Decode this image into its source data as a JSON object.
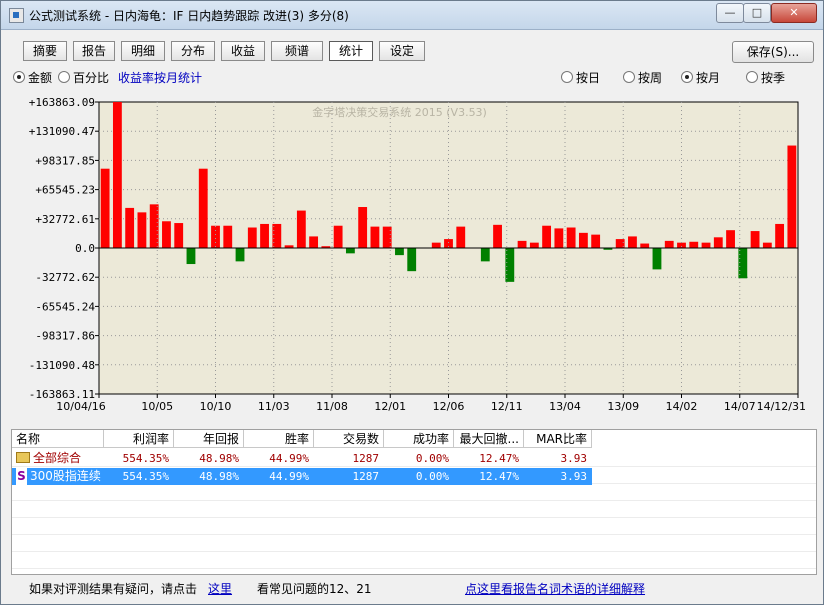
{
  "window": {
    "title": "公式测试系统 - 日内海龟：IF 日内趋势跟踪 改进(3) 多分(8)",
    "minimize": "—",
    "maximize": "□",
    "close": "✕"
  },
  "tabs": [
    {
      "label": "摘要"
    },
    {
      "label": "报告"
    },
    {
      "label": "明细"
    },
    {
      "label": "分布"
    },
    {
      "label": "收益"
    },
    {
      "label": "频谱"
    },
    {
      "label": "统计",
      "active": true
    },
    {
      "label": "设定"
    }
  ],
  "save_button": "保存(S)...",
  "options": {
    "amount": "金额",
    "percent": "百分比",
    "monthly_link": "收益率按月统计",
    "by_day": "按日",
    "by_week": "按周",
    "by_month": "按月",
    "by_quarter": "按季",
    "selected_mode": "amount",
    "selected_period": "by_month"
  },
  "chart_data": {
    "type": "bar",
    "watermark": "金字塔决策交易系统 2015 (V3.53)",
    "ylim": [
      -163863.11,
      163863.09
    ],
    "y_ticks": [
      "+163863.09",
      "+131090.47",
      "+98317.85",
      "+65545.23",
      "+32772.61",
      "0.0",
      "-32772.62",
      "-65545.24",
      "-98317.86",
      "-131090.48",
      "-163863.11"
    ],
    "x_ticks": [
      "10/04/16",
      "10/05",
      "10/10",
      "11/03",
      "11/08",
      "12/01",
      "12/06",
      "12/11",
      "13/04",
      "13/09",
      "14/02",
      "14/07",
      "14/12/31"
    ],
    "grid": true,
    "colors": {
      "positive": "#ff0000",
      "negative": "#008000",
      "background": "#ece9d8"
    },
    "values": [
      89000,
      163863,
      45000,
      40000,
      49000,
      30000,
      28000,
      -18000,
      89000,
      25000,
      25000,
      -15000,
      23000,
      27000,
      27000,
      3000,
      42000,
      13000,
      2000,
      25000,
      -6000,
      46000,
      24000,
      24000,
      -8000,
      -26000,
      0,
      6000,
      10000,
      24000,
      0,
      -15000,
      26000,
      -38000,
      8000,
      6000,
      25000,
      22000,
      23000,
      17000,
      15000,
      -2000,
      10000,
      13000,
      5000,
      -24000,
      8000,
      6000,
      7000,
      6000,
      12000,
      20000,
      -34000,
      19000,
      6000,
      27000,
      115000
    ]
  },
  "table": {
    "columns": [
      "名称",
      "利润率",
      "年回报",
      "胜率",
      "交易数",
      "成功率",
      "最大回撤...",
      "MAR比率"
    ],
    "rows": [
      {
        "icon": "folder-icon",
        "name": "全部综合",
        "profit": "554.35%",
        "annual": "48.98%",
        "win": "44.99%",
        "trades": "1287",
        "success": "0.00%",
        "drawdown": "12.47%",
        "mar": "3.93"
      },
      {
        "icon": "S",
        "name": "300股指连续",
        "profit": "554.35%",
        "annual": "48.98%",
        "win": "44.99%",
        "trades": "1287",
        "success": "0.00%",
        "drawdown": "12.47%",
        "mar": "3.93"
      }
    ]
  },
  "status": {
    "question": "如果对评测结果有疑问，请点击",
    "here_link": "这里",
    "faq": "看常见问题的12、21",
    "glossary_link": "点这里看报告名词术语的详细解释"
  }
}
